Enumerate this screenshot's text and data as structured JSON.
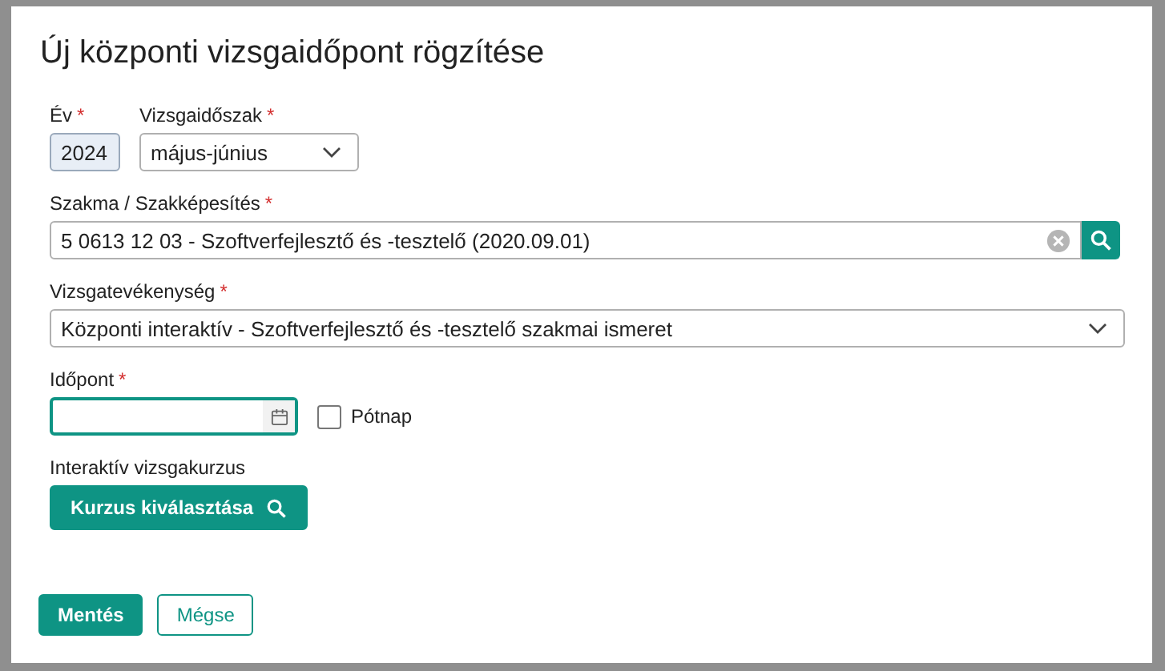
{
  "dialog": {
    "title": "Új központi vizsgaidőpont rögzítése"
  },
  "year": {
    "label": "Év",
    "mark": "*",
    "value": "2024",
    "disabled": true
  },
  "period": {
    "label": "Vizsgaidőszak",
    "mark": "*",
    "value": "május-június"
  },
  "qualification": {
    "label": "Szakma / Szakképesítés",
    "mark": "*",
    "value": "5 0613 12 03 - Szoftverfejlesztő és -tesztelő (2020.09.01)"
  },
  "activity": {
    "label": "Vizsgatevékenység",
    "mark": "*",
    "value": "Központi interaktív - Szoftverfejlesztő és -tesztelő szakmai ismeret"
  },
  "date": {
    "label": "Időpont",
    "mark": "*",
    "focused": true
  },
  "makeup_day": {
    "label": "Pótnap",
    "checked": false
  },
  "course": {
    "label": "Interaktív vizsgakurzus",
    "button": "Kurzus kiválasztása"
  },
  "buttons": [
    {
      "label": "Mentés",
      "kind": "primary"
    },
    {
      "label": "Mégse",
      "kind": "outline"
    }
  ]
}
